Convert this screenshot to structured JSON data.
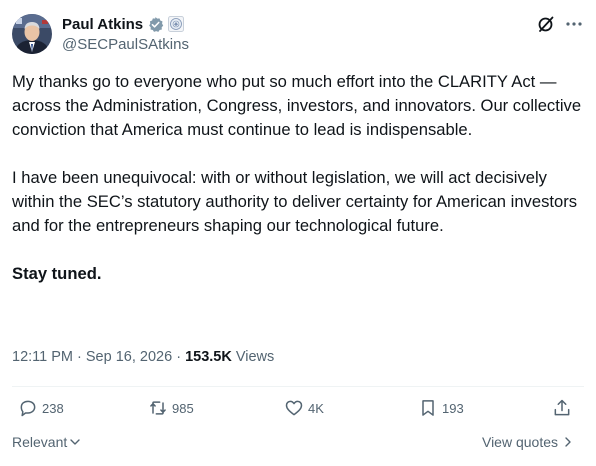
{
  "author": {
    "name": "Paul Atkins",
    "handle": "@SECPaulSAtkins"
  },
  "tweet": {
    "paragraphs": [
      "My thanks go to everyone who put so much effort into the CLARITY Act — across the Administration, Congress, investors, and innovators. Our collective conviction that America must continue to lead is indispensable.",
      "I have been unequivocal: with or without legislation, we will act decisively within the SEC’s statutory authority to deliver certainty for American investors and for the entrepreneurs shaping our technological future."
    ],
    "closing": "Stay tuned."
  },
  "meta": {
    "time": "12:11 PM",
    "separator": " · ",
    "date": "Sep 16, 2026",
    "views_count": "153.5K",
    "views_label": " Views"
  },
  "actions": {
    "replies": "238",
    "reposts": "985",
    "likes": "4K",
    "bookmarks": "193"
  },
  "footer": {
    "sort_label": "Relevant",
    "quotes_label": "View quotes"
  },
  "icons": {
    "verified": "verified-badge-icon",
    "affiliate": "government-seal-icon",
    "grok": "grok-icon",
    "more": "more-options-icon"
  },
  "colors": {
    "text": "#0f1419",
    "secondary": "#536471",
    "divider": "#eff3f4"
  }
}
